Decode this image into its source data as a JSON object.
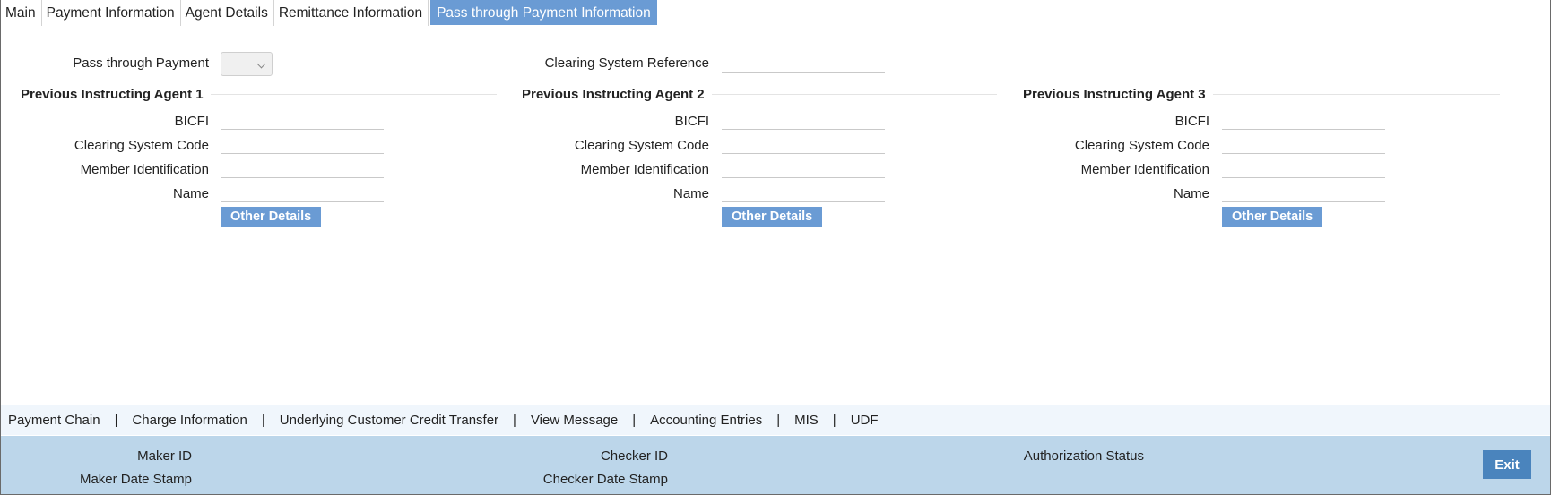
{
  "tabs": [
    {
      "label": "Main"
    },
    {
      "label": "Payment Information"
    },
    {
      "label": "Agent Details"
    },
    {
      "label": "Remittance Information"
    },
    {
      "label": "Pass through Payment Information",
      "active": true
    }
  ],
  "top": {
    "pass_through_label": "Pass through Payment",
    "pass_through_value": "",
    "clearing_ref_label": "Clearing System Reference",
    "clearing_ref_value": ""
  },
  "agents": [
    {
      "title": "Previous Instructing Agent 1",
      "bicfi_label": "BICFI",
      "bicfi_value": "",
      "csc_label": "Clearing System Code",
      "csc_value": "",
      "member_label": "Member Identification",
      "member_value": "",
      "name_label": "Name",
      "name_value": "",
      "other_details_label": "Other Details"
    },
    {
      "title": "Previous Instructing Agent 2",
      "bicfi_label": "BICFI",
      "bicfi_value": "",
      "csc_label": "Clearing System Code",
      "csc_value": "",
      "member_label": "Member Identification",
      "member_value": "",
      "name_label": "Name",
      "name_value": "",
      "other_details_label": "Other Details"
    },
    {
      "title": "Previous Instructing Agent 3",
      "bicfi_label": "BICFI",
      "bicfi_value": "",
      "csc_label": "Clearing System Code",
      "csc_value": "",
      "member_label": "Member Identification",
      "member_value": "",
      "name_label": "Name",
      "name_value": "",
      "other_details_label": "Other Details"
    }
  ],
  "footer_links": [
    "Payment Chain",
    "Charge Information",
    "Underlying Customer Credit Transfer",
    "View Message",
    "Accounting Entries",
    "MIS",
    "UDF"
  ],
  "footer_separator": "|",
  "audit": {
    "maker_id": "Maker ID",
    "maker_date": "Maker Date Stamp",
    "checker_id": "Checker ID",
    "checker_date": "Checker Date Stamp",
    "auth_status": "Authorization Status",
    "exit_label": "Exit"
  },
  "colors": {
    "accent": "#6a9bd4",
    "exit_button": "#4a84bd",
    "audit_bar": "#bcd6ea",
    "link_bar": "#f0f6fc"
  }
}
